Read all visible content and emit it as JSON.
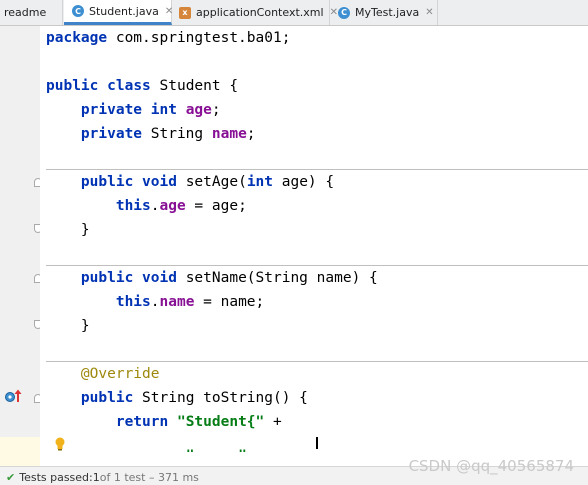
{
  "tabs": [
    {
      "label": "readme",
      "icon": "none",
      "active": false
    },
    {
      "label": "Student.java",
      "icon": "class-icon",
      "active": true
    },
    {
      "label": "applicationContext.xml",
      "icon": "xml-file-icon",
      "active": false
    },
    {
      "label": "MyTest.java",
      "icon": "test-class-icon",
      "active": false
    }
  ],
  "code": {
    "package_kw": "package",
    "package_name": " com.springtest.ba01;",
    "public": "public",
    "class": "class",
    "class_name": " Student {",
    "private": "private",
    "int": "int",
    "age": "age",
    "string_type": " String ",
    "name": "name",
    "semicolon": ";",
    "void": "void",
    "set_age_sig": " setAge(",
    "set_age_param": " age) {",
    "this": "this",
    "dot": ".",
    "assign_age": " = age;",
    "close_brace": "}",
    "set_name_sig": " setName(String name) {",
    "assign_name": " = name;",
    "annotation": "@Override",
    "to_string_sig": " String toString() {",
    "return": "return",
    "student_str": "\"Student{\"",
    "plus": " +",
    "partial_str": "\"     \""
  },
  "status": {
    "tests_text": "Tests passed: ",
    "passed_count": "1",
    "of_text": " of 1 test – 371 ms"
  },
  "watermark": "CSDN @qq_40565874",
  "colors": {
    "keyword": "#0033b3",
    "field": "#871094",
    "string": "#067d17",
    "annotation": "#9e880d",
    "active_tab_underline": "#4083c9"
  }
}
